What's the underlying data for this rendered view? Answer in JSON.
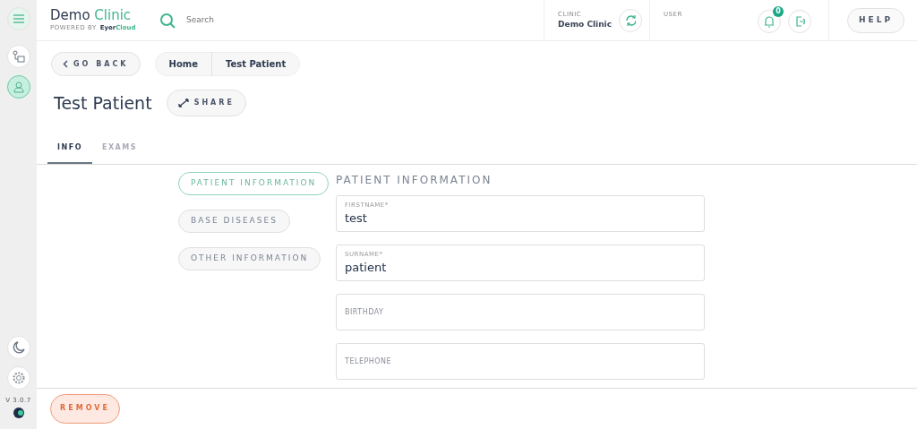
{
  "header": {
    "title_parts": [
      "Demo",
      "Clinic"
    ],
    "powered_by": "POWERED BY",
    "brand_parts": [
      "Eyer",
      "Cloud"
    ],
    "search": {
      "placeholder": "Search"
    },
    "clinic": {
      "label": "CLINIC",
      "value": "Demo Clinic"
    },
    "user": {
      "label": "USER"
    },
    "notifications": "0",
    "help": "HELP"
  },
  "sidebar": {
    "items": [
      {
        "kind": "tree",
        "selected": false
      },
      {
        "kind": "patient",
        "selected": true
      }
    ],
    "version": "V 3.0.7"
  },
  "back": "GO BACK",
  "breadcrumb": [
    "Home",
    "Test Patient"
  ],
  "title": "Test Patient",
  "share": "SHARE",
  "tabs": [
    {
      "label": "INFO",
      "selected": true
    },
    {
      "label": "EXAMS",
      "selected": false
    }
  ],
  "sections": [
    {
      "label": "PATIENT INFORMATION",
      "selected": true
    },
    {
      "label": "BASE DISEASES",
      "selected": false
    },
    {
      "label": "OTHER INFORMATION",
      "selected": false
    }
  ],
  "form": {
    "heading": "PATIENT INFORMATION",
    "fields": [
      {
        "label": "FIRSTNAME*",
        "value": "test"
      },
      {
        "label": "SURNAME*",
        "value": "patient"
      },
      {
        "label": "BIRTHDAY"
      },
      {
        "label": "TELEPHONE"
      }
    ]
  },
  "remove": "REMOVE"
}
